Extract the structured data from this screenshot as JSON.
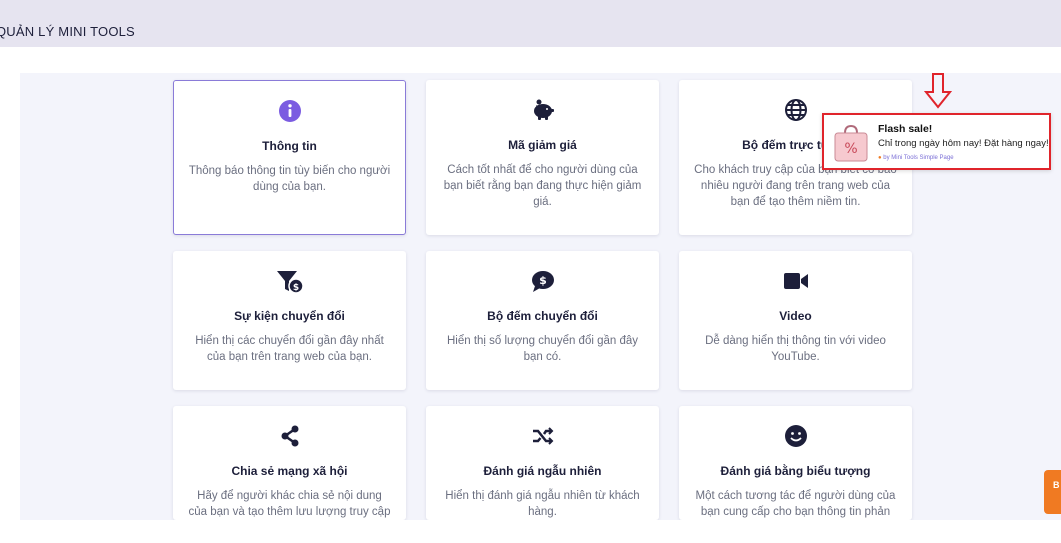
{
  "header": {
    "title": "QUẢN LÝ MINI TOOLS"
  },
  "cards": [
    {
      "title": "Thông tin",
      "desc": "Thông báo thông tin tùy biến cho người dùng của bạn.",
      "icon": "info-circle-icon"
    },
    {
      "title": "Mã giảm giá",
      "desc": "Cách tốt nhất để cho người dùng của bạn biết rằng bạn đang thực hiện giảm giá.",
      "icon": "piggy-bank-icon"
    },
    {
      "title": "Bộ đếm trực tuyến",
      "desc": "Cho khách truy cập của bạn biết có bao nhiêu người đang trên trang web của bạn để tạo thêm niềm tin.",
      "icon": "globe-icon"
    },
    {
      "title": "Sự kiện chuyển đổi",
      "desc": "Hiển thị các chuyển đổi gần đây nhất của bạn trên trang web của bạn.",
      "icon": "funnel-dollar-icon"
    },
    {
      "title": "Bộ đếm chuyển đổi",
      "desc": "Hiển thị số lượng chuyển đổi gần đây bạn có.",
      "icon": "comment-dollar-icon"
    },
    {
      "title": "Video",
      "desc": "Dễ dàng hiển thị thông tin với video YouTube.",
      "icon": "video-camera-icon"
    },
    {
      "title": "Chia sẻ mạng xã hội",
      "desc": "Hãy để người khác chia sẻ nội dung của bạn và tạo thêm lưu lượng truy cập cho",
      "icon": "share-icon"
    },
    {
      "title": "Đánh giá ngẫu nhiên",
      "desc": "Hiển thị đánh giá ngẫu nhiên từ khách hàng.",
      "icon": "shuffle-icon"
    },
    {
      "title": "Đánh giá bằng biểu tượng",
      "desc": "Một cách tương tác để người dùng của bạn cung cấp cho bạn thông tin phản hồi",
      "icon": "smile-icon"
    }
  ],
  "popup": {
    "title": "Flash sale!",
    "message": "Chỉ trong ngày hôm nay! Đặt hàng ngay!",
    "by": "by Mini Tools Simple Page",
    "image_icon": "shopping-bag-percent-icon"
  },
  "side_tab": {
    "label": "B"
  },
  "colors": {
    "accent": "#7b5ce1",
    "icon": "#1d1f3a",
    "highlight": "#e0242b",
    "side_tab": "#f07a22"
  }
}
